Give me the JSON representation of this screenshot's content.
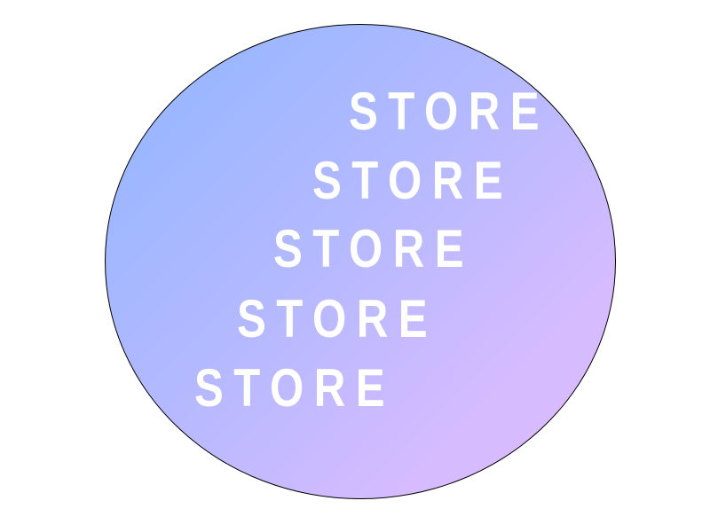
{
  "logo": {
    "words": [
      "STORE",
      "STORE",
      "STORE",
      "STORE",
      "STORE"
    ]
  },
  "colors": {
    "gradient_start": "#8fb6ff",
    "gradient_end": "#dcbcff",
    "text": "#ffffff",
    "outline": "#000000",
    "background": "#ffffff"
  }
}
